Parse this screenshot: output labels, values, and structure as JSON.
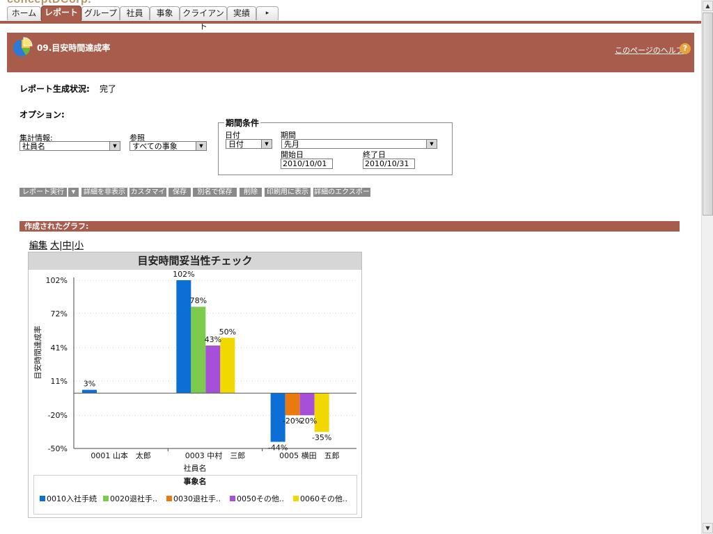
{
  "brand": {
    "logo_text": "conceptDCorp."
  },
  "tabs": [
    {
      "label": "ホーム",
      "active": false
    },
    {
      "label": "レポート",
      "active": true
    },
    {
      "label": "グループ",
      "active": false
    },
    {
      "label": "社員",
      "active": false
    },
    {
      "label": "事象",
      "active": false
    },
    {
      "label": "クライアント",
      "active": false
    },
    {
      "label": "実績",
      "active": false
    },
    {
      "label": "▸",
      "active": false
    }
  ],
  "header": {
    "title": "09.目安時間達成率",
    "help_link": "このページのヘルプ",
    "help_icon": "?"
  },
  "status": {
    "label": "レポート生成状況:",
    "value": "完了"
  },
  "options": {
    "label": "オプション:",
    "aggregate": {
      "label": "集計情報:",
      "value": "社員名"
    },
    "reference": {
      "label": "参照",
      "value": "すべての事象"
    },
    "period": {
      "legend": "期間条件",
      "date_label": "日付",
      "date_value": "日付",
      "period_label": "期間",
      "period_value": "先月",
      "start_label": "開始日",
      "start_value": "2010/10/01",
      "end_label": "終了日",
      "end_value": "2010/10/31"
    }
  },
  "toolbar": {
    "run": "レポート実行",
    "hide_details": "詳細を非表示",
    "customize": "カスタマイズ",
    "save": "保存",
    "save_as": "別名で保存",
    "delete": "削除",
    "print": "印刷用に表示",
    "export": "詳細のエクスポート"
  },
  "graph_section": {
    "title": "作成されたグラフ:"
  },
  "graph_links": {
    "edit": "編集",
    "large": "大",
    "medium": "中",
    "small": "小",
    "sep": "|"
  },
  "colors": {
    "accent": "#a85c4b",
    "s1": "#0b6fd6",
    "s2": "#7ccb4c",
    "s3": "#e87a10",
    "s4": "#a64fd8",
    "s5": "#f0d800"
  },
  "chart_data": {
    "type": "bar",
    "title": "目安時間妥当性チェック",
    "xlabel": "社員名",
    "ylabel": "目安時間達成率",
    "categories": [
      "0001 山本　太郎",
      "0003 中村　三郎",
      "0005 横田　五郎"
    ],
    "yticks": [
      "102%",
      "72%",
      "41%",
      "11%",
      "-20%",
      "-50%"
    ],
    "ylim": [
      -50,
      102
    ],
    "legend_title": "事象名",
    "series": [
      {
        "name": "0010入社手続",
        "color": "#0b6fd6",
        "values": [
          3,
          102,
          -44
        ]
      },
      {
        "name": "0020退社手..",
        "color": "#7ccb4c",
        "values": [
          null,
          78,
          null
        ]
      },
      {
        "name": "0030退社手..",
        "color": "#e87a10",
        "values": [
          null,
          null,
          -20
        ]
      },
      {
        "name": "0050その他..",
        "color": "#a64fd8",
        "values": [
          null,
          43,
          -20
        ]
      },
      {
        "name": "0060その他..",
        "color": "#f0d800",
        "values": [
          null,
          50,
          -35
        ]
      }
    ],
    "data_labels": [
      [
        "3%",
        "102%",
        "-44%"
      ],
      [
        "",
        "78%",
        ""
      ],
      [
        "",
        "",
        "-20%"
      ],
      [
        "",
        "43%",
        "-20%"
      ],
      [
        "",
        "50%",
        "-35%"
      ]
    ],
    "grid": true,
    "legend_position": "bottom"
  }
}
